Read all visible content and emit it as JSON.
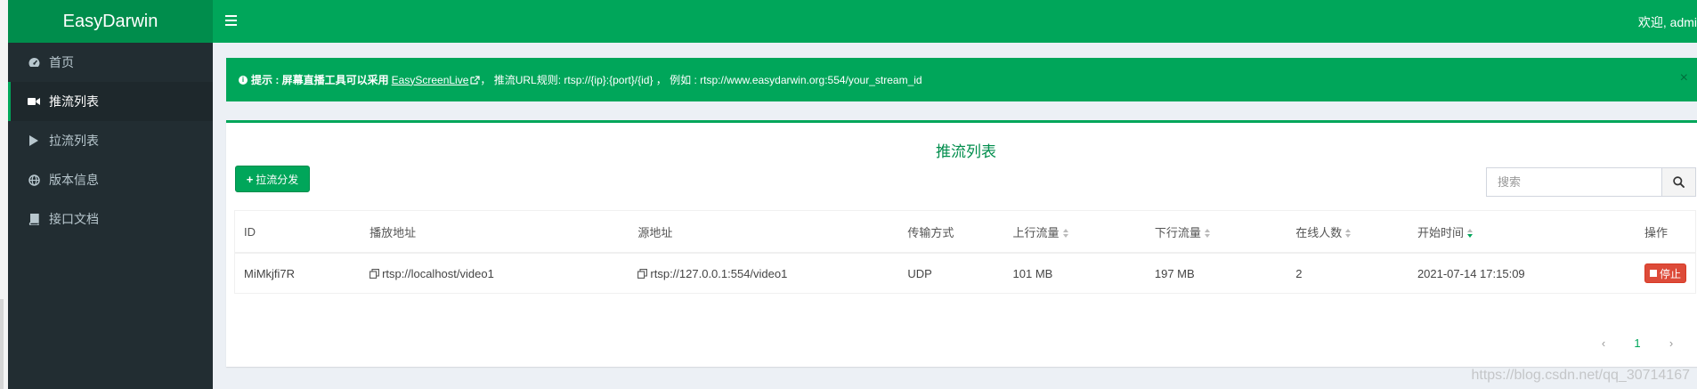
{
  "brand": "EasyDarwin",
  "topbar": {
    "welcome": "欢迎, admi"
  },
  "sidebar": {
    "items": [
      {
        "label": "首页",
        "icon": "dashboard-icon",
        "active": false
      },
      {
        "label": "推流列表",
        "icon": "video-camera-icon",
        "active": true
      },
      {
        "label": "拉流列表",
        "icon": "play-icon",
        "active": false
      },
      {
        "label": "版本信息",
        "icon": "globe-icon",
        "active": false
      },
      {
        "label": "接口文档",
        "icon": "book-icon",
        "active": false
      }
    ]
  },
  "callout": {
    "prefix": "提示 : 屏幕直播工具可以采用",
    "link": "EasyScreenLive",
    "suffix": "， 推流URL规则: rtsp://{ip}:{port}/{id} ，  例如 : rtsp://www.easydarwin.org:554/your_stream_id",
    "close": "×"
  },
  "box": {
    "title": "推流列表",
    "add_button": "拉流分发",
    "search_placeholder": "搜索"
  },
  "table": {
    "headers": {
      "id": "ID",
      "play_url": "播放地址",
      "source_url": "源地址",
      "transport": "传输方式",
      "upstream": "上行流量",
      "downstream": "下行流量",
      "online": "在线人数",
      "start_time": "开始时间",
      "action": "操作"
    },
    "rows": [
      {
        "id": "MiMkjfi7R",
        "play_url": "rtsp://localhost/video1",
        "source_url": "rtsp://127.0.0.1:554/video1",
        "transport": "UDP",
        "upstream": "101 MB",
        "downstream": "197 MB",
        "online": "2",
        "start_time": "2021-07-14 17:15:09",
        "action": "停止"
      }
    ]
  },
  "pager": {
    "prev": "‹",
    "current": "1",
    "next": "›"
  },
  "watermark": "https://blog.csdn.net/qq_30714167",
  "colors": {
    "primary": "#00a65a",
    "primary_dark": "#008d4c",
    "sidebar": "#222d32",
    "danger": "#dd4b39"
  }
}
